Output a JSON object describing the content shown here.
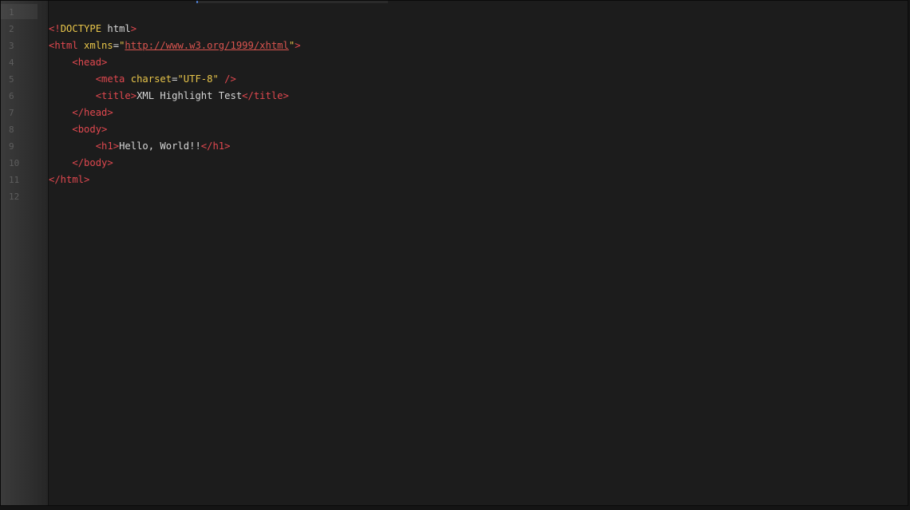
{
  "editor": {
    "line_numbers": [
      "1",
      "2",
      "3",
      "4",
      "5",
      "6",
      "7",
      "8",
      "9",
      "10",
      "11",
      "12"
    ],
    "lines": [
      [],
      [
        {
          "t": "<!",
          "c": "tag"
        },
        {
          "t": "DOCTYPE",
          "c": "doc"
        },
        {
          "t": " html",
          "c": "text"
        },
        {
          "t": ">",
          "c": "tag"
        }
      ],
      [
        {
          "t": "<html ",
          "c": "tag"
        },
        {
          "t": "xmlns",
          "c": "attr"
        },
        {
          "t": "=",
          "c": "text"
        },
        {
          "t": "\"",
          "c": "str"
        },
        {
          "t": "http://www.w3.org/1999/xhtml",
          "c": "link"
        },
        {
          "t": "\"",
          "c": "str"
        },
        {
          "t": ">",
          "c": "tag"
        }
      ],
      [
        {
          "t": "    ",
          "c": "text"
        },
        {
          "t": "<head>",
          "c": "tag"
        }
      ],
      [
        {
          "t": "        ",
          "c": "text"
        },
        {
          "t": "<meta ",
          "c": "tag"
        },
        {
          "t": "charset",
          "c": "attr"
        },
        {
          "t": "=",
          "c": "text"
        },
        {
          "t": "\"UTF-8\"",
          "c": "str"
        },
        {
          "t": " />",
          "c": "tag"
        }
      ],
      [
        {
          "t": "        ",
          "c": "text"
        },
        {
          "t": "<title>",
          "c": "tag"
        },
        {
          "t": "XML Highlight Test",
          "c": "text"
        },
        {
          "t": "</title>",
          "c": "tag"
        }
      ],
      [
        {
          "t": "    ",
          "c": "text"
        },
        {
          "t": "</head>",
          "c": "tag"
        }
      ],
      [
        {
          "t": "    ",
          "c": "text"
        },
        {
          "t": "<body>",
          "c": "tag"
        }
      ],
      [
        {
          "t": "        ",
          "c": "text"
        },
        {
          "t": "<h1>",
          "c": "tag"
        },
        {
          "t": "Hello, World!!",
          "c": "text"
        },
        {
          "t": "</h1>",
          "c": "tag"
        }
      ],
      [
        {
          "t": "    ",
          "c": "text"
        },
        {
          "t": "</body>",
          "c": "tag"
        }
      ],
      [
        {
          "t": "</html>",
          "c": "tag"
        }
      ],
      []
    ]
  },
  "colors": {
    "background": "#1c1c1c",
    "tag": "#e0484f",
    "attribute": "#e8c54a",
    "string": "#e8c54a",
    "text": "#d6d6d6",
    "line_number": "#5e5e5e"
  }
}
